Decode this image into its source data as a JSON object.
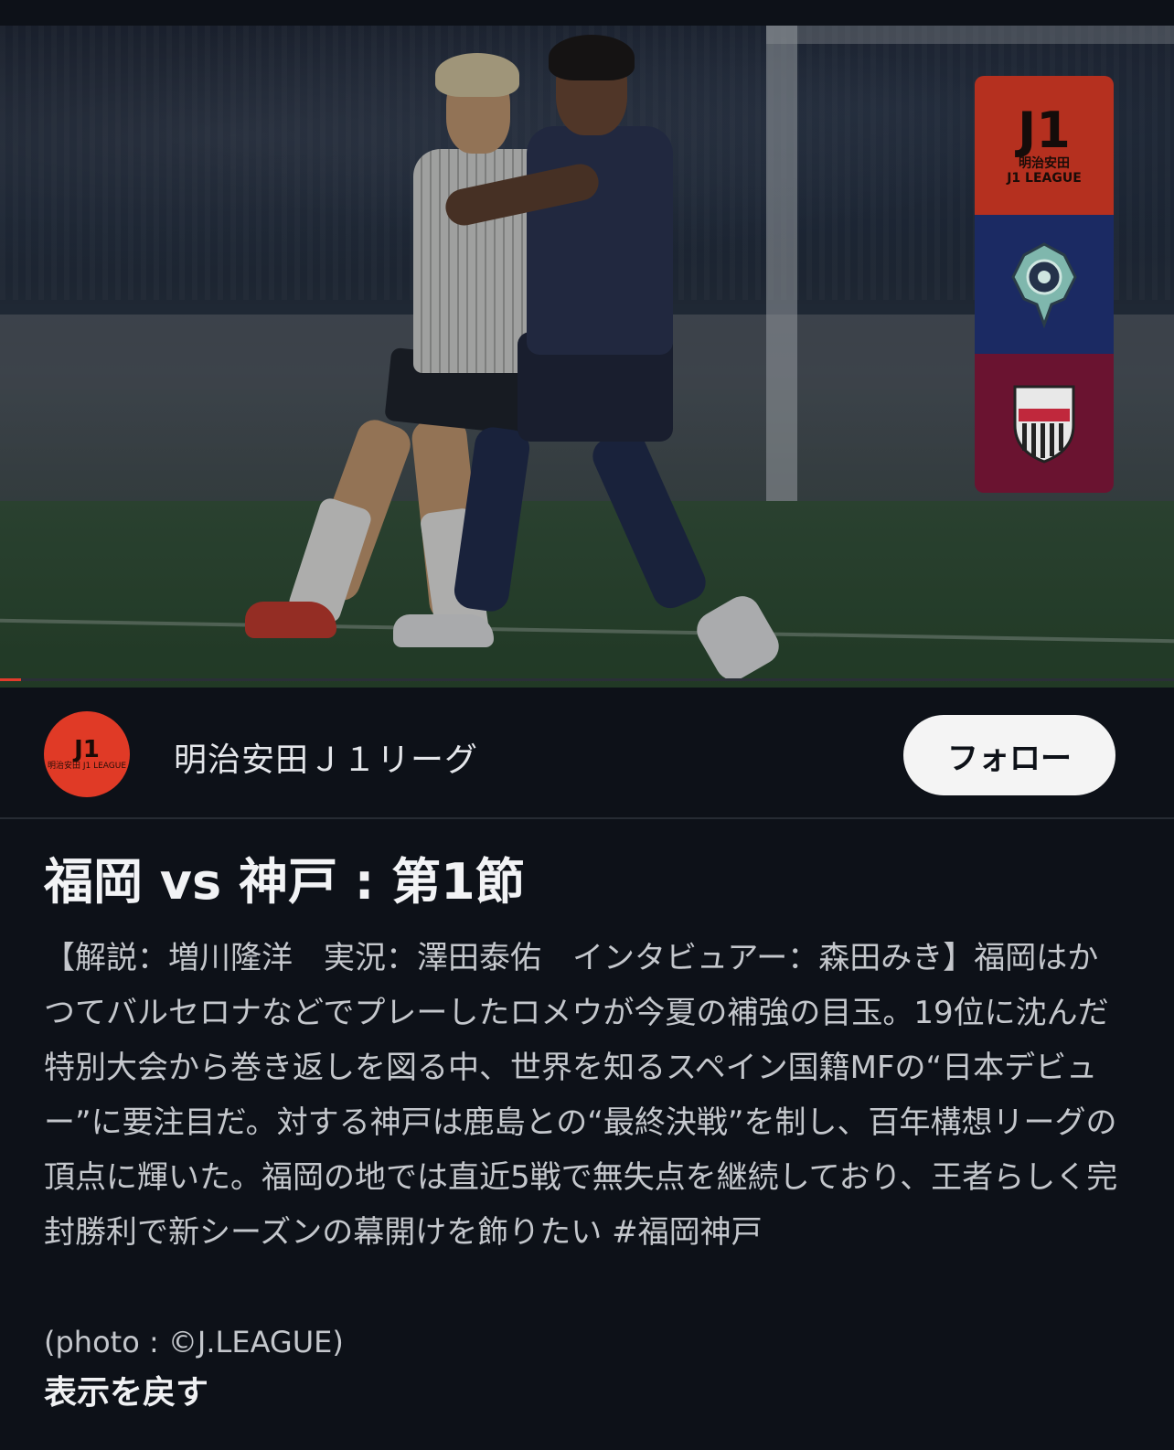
{
  "video": {
    "progress_fraction": 0.018,
    "badges": [
      {
        "name": "j1-league",
        "text_main": "J1",
        "text_sub": "明治安田\nJ1 LEAGUE",
        "color": "#b5301f"
      },
      {
        "name": "avispa-fukuoka",
        "color": "#1b2a63"
      },
      {
        "name": "vissel-kobe",
        "color": "#6a1330"
      }
    ]
  },
  "channel": {
    "avatar_main": "J1",
    "avatar_sub": "明治安田 J1 LEAGUE",
    "name": "明治安田Ｊ１リーグ",
    "follow_label": "フォロー"
  },
  "post": {
    "title": "福岡 vs 神戸 : 第1節",
    "description": "【解説：増川隆洋　実況：澤田泰佑　インタビュアー：森田みき】福岡はかつてバルセロナなどでプレーしたロメウが今夏の補強の目玉。19位に沈んだ特別大会から巻き返しを図る中、世界を知るスペイン国籍MFの“日本デビュー”に要注目だ。対する神戸は鹿島との“最終決戦”を制し、百年構想リーグの頂点に輝いた。福岡の地では直近5戦で無失点を継続しており、王者らしく完封勝利で新シーズンの幕開けを飾りたい #福岡神戸",
    "photo_credit": "(photo : ©J.LEAGUE)",
    "collapse_label": "表示を戻す"
  },
  "colors": {
    "background": "#0d1118",
    "accent": "#e23b2c",
    "follow_bg": "#f4f4f4"
  }
}
